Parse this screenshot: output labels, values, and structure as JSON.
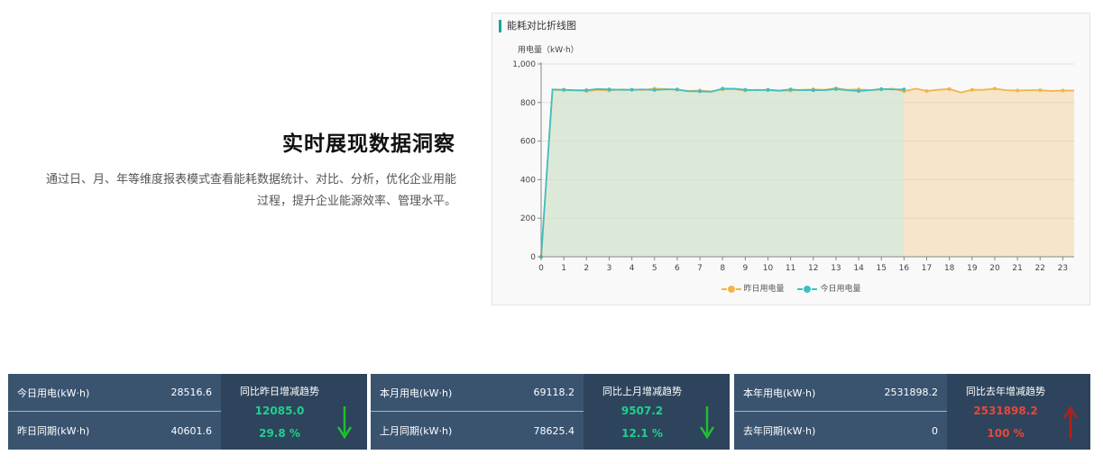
{
  "hero": {
    "title": "实时展现数据洞察",
    "description": "通过日、月、年等维度报表模式查看能耗数据统计、对比、分析，优化企业用能过程，提升企业能源效率、管理水平。"
  },
  "chart_data": {
    "type": "area",
    "title": "能耗对比折线图",
    "ylabel": "用电量（kW·h）",
    "xlabel": "",
    "ylim": [
      0,
      1000
    ],
    "y_ticks": [
      "0",
      "200",
      "400",
      "600",
      "800",
      "1,000"
    ],
    "x_ticks": [
      "0",
      "1",
      "2",
      "3",
      "4",
      "5",
      "6",
      "7",
      "8",
      "9",
      "10",
      "11",
      "12",
      "13",
      "14",
      "15",
      "16",
      "17",
      "18",
      "19",
      "20",
      "21",
      "22",
      "23"
    ],
    "grid": true,
    "legend_position": "bottom",
    "series": [
      {
        "name": "昨日用电量",
        "color": "#f2b44a",
        "x": [
          0,
          0.5,
          1,
          1.5,
          2,
          2.5,
          3,
          3.5,
          4,
          4.5,
          5,
          5.5,
          6,
          6.5,
          7,
          7.5,
          8,
          8.5,
          9,
          9.5,
          10,
          10.5,
          11,
          11.5,
          12,
          12.5,
          13,
          13.5,
          14,
          14.5,
          15,
          15.5,
          16,
          16.5,
          17,
          17.5,
          18,
          18.5,
          19,
          19.5,
          20,
          20.5,
          21,
          21.5,
          22,
          22.5,
          23,
          23.5
        ],
        "values": [
          0,
          866,
          865,
          862,
          860,
          865,
          862,
          868,
          866,
          865,
          872,
          870,
          866,
          860,
          862,
          858,
          868,
          870,
          862,
          866,
          864,
          860,
          862,
          866,
          868,
          866,
          874,
          866,
          868,
          864,
          868,
          872,
          858,
          872,
          860,
          866,
          870,
          852,
          866,
          866,
          872,
          864,
          862,
          864,
          864,
          860,
          862,
          862
        ]
      },
      {
        "name": "今日用电量",
        "color": "#3fbfc2",
        "x": [
          0,
          0.5,
          1,
          1.5,
          2,
          2.5,
          3,
          3.5,
          4,
          4.5,
          5,
          5.5,
          6,
          6.5,
          7,
          7.5,
          8,
          8.5,
          9,
          9.5,
          10,
          10.5,
          11,
          11.5,
          12,
          12.5,
          13,
          13.5,
          14,
          14.5,
          15,
          15.5,
          16
        ],
        "values": [
          0,
          868,
          866,
          864,
          864,
          870,
          868,
          866,
          866,
          868,
          865,
          868,
          868,
          858,
          858,
          856,
          872,
          872,
          866,
          864,
          866,
          862,
          868,
          864,
          864,
          864,
          870,
          864,
          860,
          864,
          870,
          868,
          868
        ]
      }
    ]
  },
  "stats": [
    {
      "current_label": "今日用电(kW·h)",
      "current_value": "28516.6",
      "previous_label": "昨日同期(kW·h)",
      "previous_value": "40601.6",
      "compare_title": "同比昨日增减趋势",
      "compare_value": "12085.0",
      "compare_percent": "29.8 %",
      "trend": "down",
      "trend_color": "#1fbf2f"
    },
    {
      "current_label": "本月用电(kW·h)",
      "current_value": "69118.2",
      "previous_label": "上月同期(kW·h)",
      "previous_value": "78625.4",
      "compare_title": "同比上月增减趋势",
      "compare_value": "9507.2",
      "compare_percent": "12.1 %",
      "trend": "down",
      "trend_color": "#1fbf2f"
    },
    {
      "current_label": "本年用电(kW·h)",
      "current_value": "2531898.2",
      "previous_label": "去年同期(kW·h)",
      "previous_value": "0",
      "compare_title": "同比去年增减趋势",
      "compare_value": "2531898.2",
      "compare_percent": "100 %",
      "trend": "up",
      "trend_color": "#b3201a"
    }
  ]
}
